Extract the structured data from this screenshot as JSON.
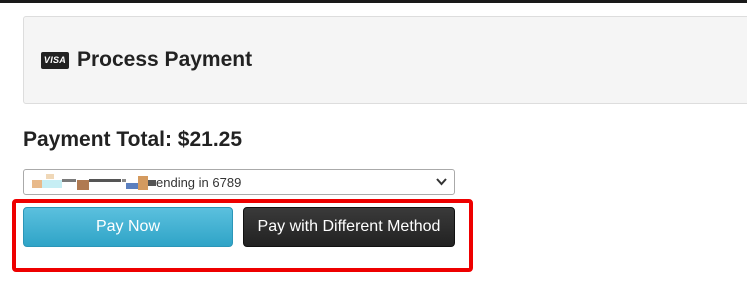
{
  "panel": {
    "title": "Process Payment",
    "card_brand": "VISA"
  },
  "payment": {
    "total_label": "Payment Total: $21.25"
  },
  "card_select": {
    "selected_suffix": "ending in 6789"
  },
  "buttons": {
    "pay_now": "Pay Now",
    "pay_other": "Pay with Different Method"
  },
  "colors": {
    "pay_now_bg": "#5bc0de",
    "pay_other_bg": "#222222",
    "highlight": "#ee0000"
  }
}
